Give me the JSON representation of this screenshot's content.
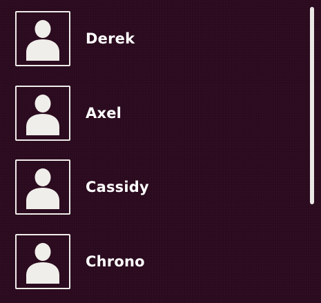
{
  "users": [
    {
      "name": "Derek",
      "avatar_icon": "default-user-icon"
    },
    {
      "name": "Axel",
      "avatar_icon": "default-user-icon"
    },
    {
      "name": "Cassidy",
      "avatar_icon": "default-user-icon"
    },
    {
      "name": "Chrono",
      "avatar_icon": "default-user-icon"
    }
  ],
  "colors": {
    "background": "#2c0a1f",
    "avatar_border": "#f0eeea",
    "avatar_fill": "#f0eeea",
    "text": "#ffffff",
    "scrollbar": "#e9e6e4"
  }
}
